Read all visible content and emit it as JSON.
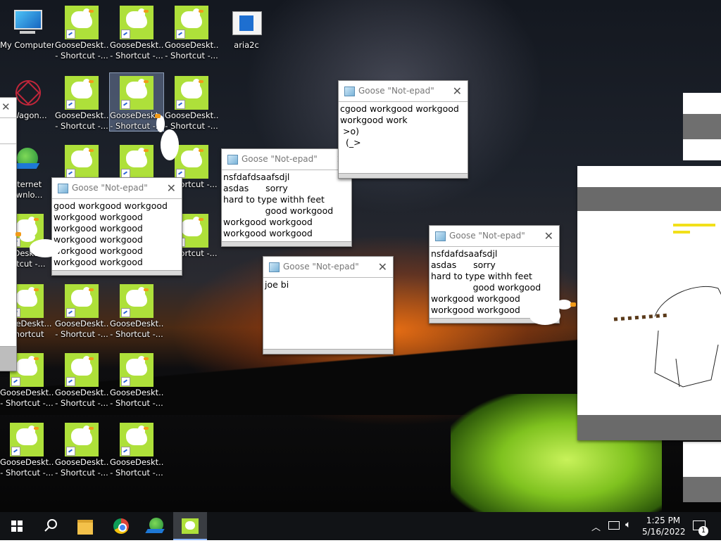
{
  "desktop": {
    "icons": [
      {
        "label1": "My Computer",
        "label2": ""
      },
      {
        "label1": "GooseDeskt...",
        "label2": "- Shortcut -..."
      },
      {
        "label1": "GooseDeskt...",
        "label2": "- Shortcut -..."
      },
      {
        "label1": "GooseDeskt...",
        "label2": "- Shortcut -..."
      },
      {
        "label1": "aria2c",
        "label2": ""
      },
      {
        "label1": "aWagon...",
        "label2": ""
      },
      {
        "label1": "GooseDeskt...",
        "label2": "- Shortcut -..."
      },
      {
        "label1": "GooseDeskt...",
        "label2": "- Shortcut -..."
      },
      {
        "label1": "GooseDeskt...",
        "label2": "- Shortcut -..."
      },
      {
        "label1": "nternet",
        "label2": "ownlo..."
      },
      {
        "label1": "ortcut -...",
        "label2": ""
      },
      {
        "label1": "eDeskt...",
        "label2": "ortcut -..."
      },
      {
        "label1": "ortcut -...",
        "label2": ""
      },
      {
        "label1": "ooseDeskt...",
        "label2": "Shortcut"
      },
      {
        "label1": "GooseDeskt...",
        "label2": "- Shortcut -..."
      },
      {
        "label1": "GooseDeskt...",
        "label2": "- Shortcut -..."
      },
      {
        "label1": "GooseDeskt...",
        "label2": "- Shortcut -..."
      },
      {
        "label1": "GooseDeskt...",
        "label2": "- Shortcut -..."
      },
      {
        "label1": "GooseDeskt...",
        "label2": "- Shortcut -..."
      },
      {
        "label1": "GooseDeskt...",
        "label2": "- Shortcut -..."
      },
      {
        "label1": "GooseDeskt...",
        "label2": "- Shortcut -..."
      },
      {
        "label1": "GooseDeskt...",
        "label2": "- Shortcut -..."
      }
    ]
  },
  "windows": {
    "w1": {
      "title": "Goose \"Not-epad\"",
      "close": "✕",
      "text": "good workgood workgood\nworkgood workgood\nworkgood workgood\nworkgood workgood\nworkgood workgood\nworkgood workgood"
    },
    "w2": {
      "title": "Goose \"Not-epad\"",
      "close": "✕",
      "text": "nsfdafdsaafsdjl\nasdas      sorry\nhard to type withh feet\n               good workgood\nworkgood workgood\nworkgood workgood"
    },
    "w3": {
      "title": "Goose \"Not-epad\"",
      "close": "✕",
      "text": "cgood workgood workgood\nworkgood work\n >o)\n  (_>"
    },
    "w4": {
      "title": "Goose \"Not-epad\"",
      "close": "✕",
      "text": "joe bi"
    },
    "w5": {
      "title": "Goose \"Not-epad\"",
      "close": "✕",
      "text": "nsfdafdsaafsdjl\nasdas      sorry\nhard to type withh feet\n               good workgood\nworkgood workgood\nworkgood workgood"
    }
  },
  "edge_window": {
    "close": "✕"
  },
  "taskbar": {
    "time": "1:25 PM",
    "date": "5/16/2022",
    "notification_count": "1"
  },
  "colors": {
    "goose_green": "#aee03a",
    "taskbar": "#111316",
    "goose_beak": "#f29a18"
  }
}
